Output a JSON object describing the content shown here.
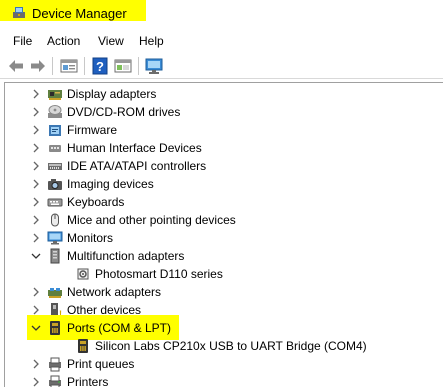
{
  "window": {
    "title": "Device Manager"
  },
  "menu": [
    "File",
    "Action",
    "View",
    "Help"
  ],
  "toolbar": [
    "back-icon",
    "forward-icon",
    "properties-icon",
    "help-icon",
    "view-icon",
    "monitor-icon"
  ],
  "highlight_color": "#ffff00",
  "tree": [
    {
      "label": "Display adapters",
      "icon": "display-adapter-icon",
      "expanded": false,
      "level": 0
    },
    {
      "label": "DVD/CD-ROM drives",
      "icon": "dvd-drive-icon",
      "expanded": false,
      "level": 0
    },
    {
      "label": "Firmware",
      "icon": "firmware-icon",
      "expanded": false,
      "level": 0
    },
    {
      "label": "Human Interface Devices",
      "icon": "hid-icon",
      "expanded": false,
      "level": 0
    },
    {
      "label": "IDE ATA/ATAPI controllers",
      "icon": "ide-controller-icon",
      "expanded": false,
      "level": 0
    },
    {
      "label": "Imaging devices",
      "icon": "camera-icon",
      "expanded": false,
      "level": 0
    },
    {
      "label": "Keyboards",
      "icon": "keyboard-icon",
      "expanded": false,
      "level": 0
    },
    {
      "label": "Mice and other pointing devices",
      "icon": "mouse-icon",
      "expanded": false,
      "level": 0
    },
    {
      "label": "Monitors",
      "icon": "monitor-icon",
      "expanded": false,
      "level": 0
    },
    {
      "label": "Multifunction adapters",
      "icon": "multifunction-icon",
      "expanded": true,
      "level": 0
    },
    {
      "label": "Photosmart D110 series",
      "icon": "printer-device-icon",
      "level": 1
    },
    {
      "label": "Network adapters",
      "icon": "network-adapter-icon",
      "expanded": false,
      "level": 0
    },
    {
      "label": "Other devices",
      "icon": "unknown-device-icon",
      "expanded": false,
      "level": 0
    },
    {
      "label": "Ports (COM & LPT)",
      "icon": "port-icon",
      "expanded": true,
      "level": 0,
      "highlighted": true
    },
    {
      "label": "Silicon Labs CP210x USB to UART Bridge (COM4)",
      "icon": "port-icon",
      "level": 1
    },
    {
      "label": "Print queues",
      "icon": "print-queue-icon",
      "expanded": false,
      "level": 0
    },
    {
      "label": "Printers",
      "icon": "printer-icon",
      "expanded": false,
      "level": 0
    }
  ]
}
